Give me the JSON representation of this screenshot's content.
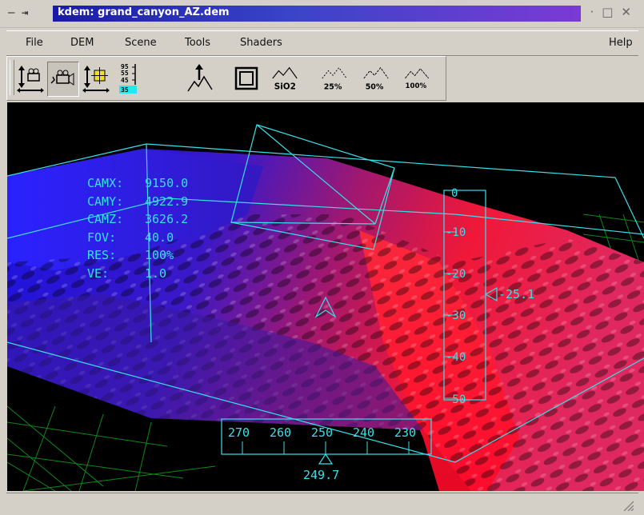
{
  "window": {
    "title": "kdem: grand_canyon_AZ.dem",
    "left_symbol": "— ⇥",
    "buttons": [
      "·",
      "□",
      "✕"
    ]
  },
  "menu": {
    "items": [
      "File",
      "DEM",
      "Scene",
      "Tools",
      "Shaders"
    ],
    "help": "Help"
  },
  "toolbar": {
    "tools": [
      {
        "icon": "camera-elevation-icon",
        "pressed": false
      },
      {
        "icon": "camera-fly-icon",
        "pressed": true
      },
      {
        "icon": "target-elevation-icon",
        "pressed": false
      },
      {
        "icon": "contour-scale-icon",
        "pressed": false,
        "text": [
          "95",
          "55",
          "45",
          "35"
        ]
      },
      {
        "icon": "peak-marker-icon",
        "pressed": false
      },
      {
        "icon": "frame-icon",
        "pressed": false
      },
      {
        "icon": "sio2-shader-icon",
        "pressed": false,
        "text": "SiO2"
      },
      {
        "icon": "res-25-icon",
        "pressed": false,
        "text": "25%"
      },
      {
        "icon": "res-50-icon",
        "pressed": false,
        "text": "50%"
      },
      {
        "icon": "res-100-icon",
        "pressed": false,
        "text": "100%"
      }
    ]
  },
  "hud": {
    "labels": [
      "CAMX:",
      "CAMY:",
      "CAMZ:",
      "FOV:",
      "RES:",
      "VE:"
    ],
    "values": [
      "9150.0",
      "4922.9",
      "3626.2",
      "40.0",
      "100%",
      "1.0"
    ]
  },
  "pitch_scale": {
    "ticks": [
      "0",
      "-10",
      "-20",
      "-30",
      "-40",
      "-50"
    ],
    "current": "-25.1"
  },
  "heading_scale": {
    "ticks": [
      "270",
      "260",
      "250",
      "240",
      "230"
    ],
    "current": "249.7"
  },
  "colors": {
    "hud": "#38e0e8",
    "title_start": "#1a1aa8",
    "title_end": "#7a3ad6",
    "terrain_low": "#2a14d8",
    "terrain_high": "#ff1030",
    "grid": "#10a020"
  }
}
